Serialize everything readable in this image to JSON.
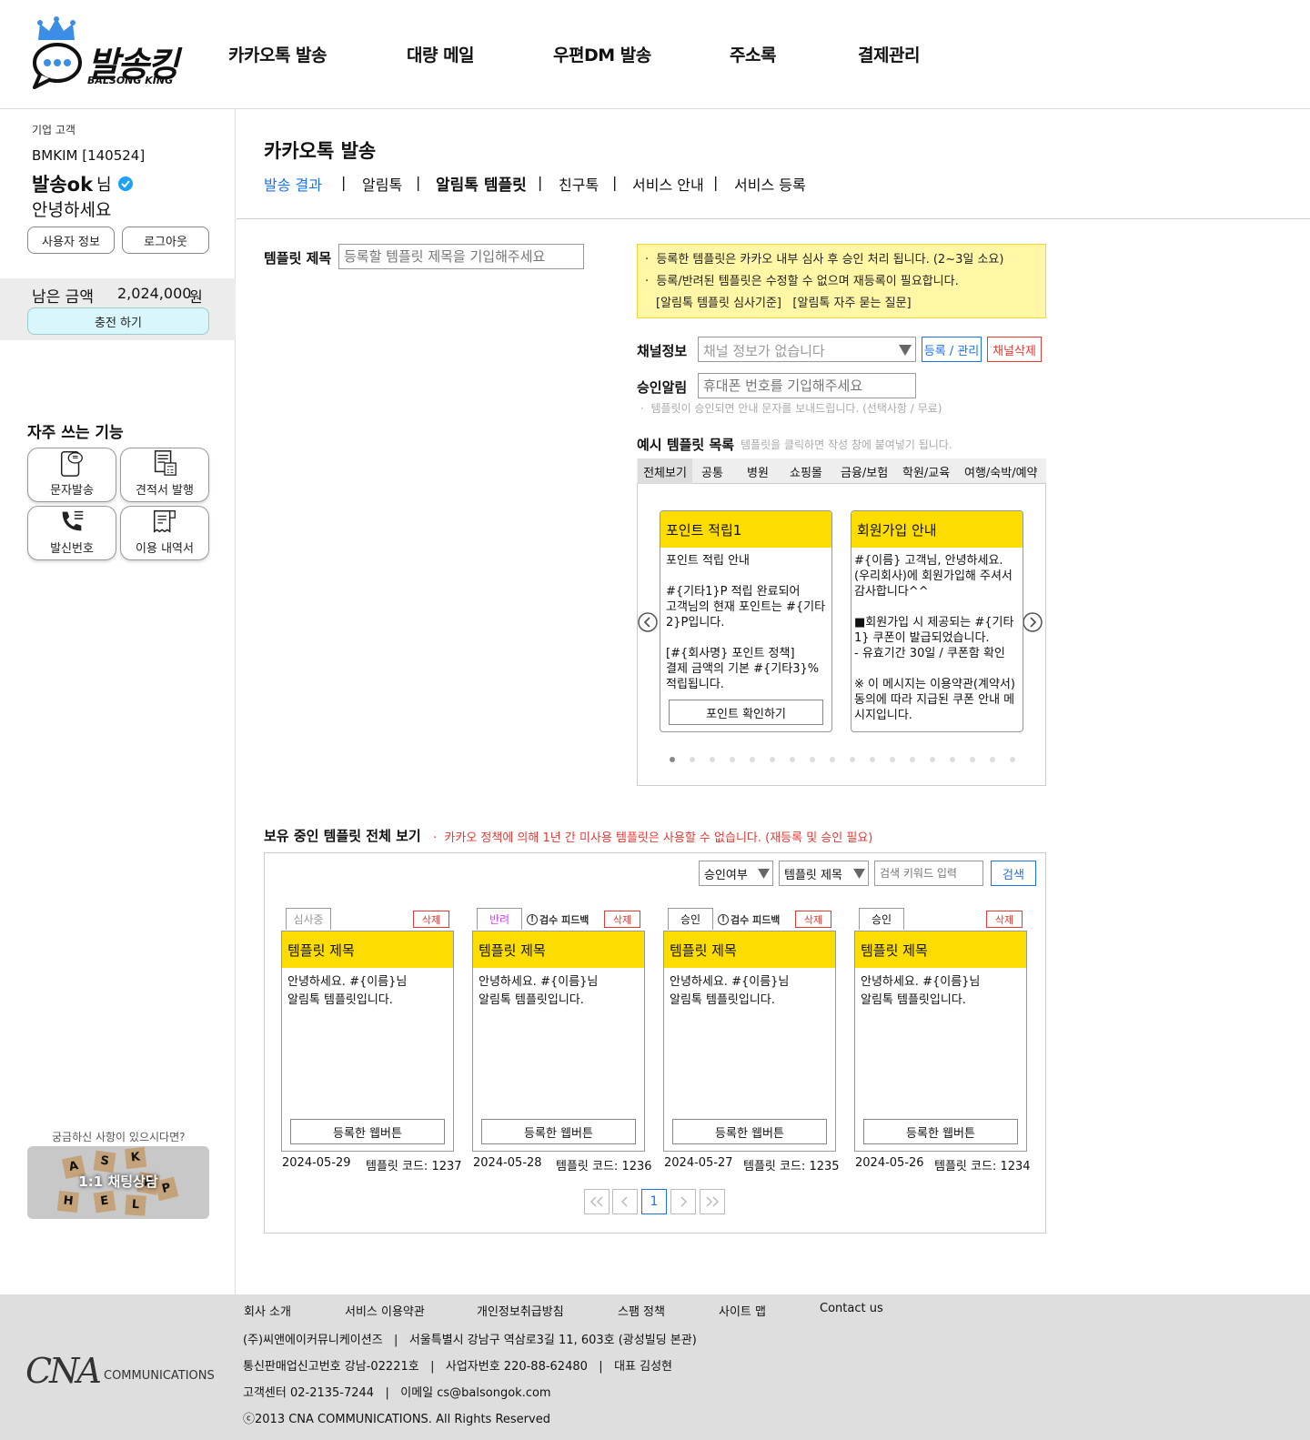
{
  "brand": {
    "name": "발송킹",
    "sub": "BALSONG KING"
  },
  "nav": [
    "카카오톡 발송",
    "대량 메일",
    "우편DM 발송",
    "주소록",
    "결제관리"
  ],
  "user": {
    "type": "기업 고객",
    "id": "BMKIM",
    "code": "[140524]",
    "name": "발송ok",
    "suffix": "님",
    "greeting": "안녕하세요",
    "user_info_btn": "사용자 정보",
    "logout_btn": "로그아웃"
  },
  "balance": {
    "label": "남은 금액",
    "amount": "2,024,000",
    "unit": "원",
    "charge_btn": "충전 하기"
  },
  "quick": {
    "title": "자주 쓰는 기능",
    "items": [
      "문자발송",
      "견적서 발행",
      "발신번호",
      "이용 내역서"
    ]
  },
  "chat": {
    "question": "궁금하신 사항이 있으시다면?",
    "label": "1:1 채팅상담",
    "tiles": [
      "A",
      "S",
      "K",
      "R",
      "P",
      "H",
      "E",
      "L"
    ]
  },
  "page": {
    "title": "카카오톡 발송",
    "subtabs": [
      "발송 결과",
      "알림톡",
      "알림톡 템플릿",
      "친구톡",
      "서비스 안내",
      "서비스 등록"
    ],
    "sep": "|"
  },
  "form": {
    "template_title_label": "템플릿 제목",
    "template_title_placeholder": "등록할 템플릿 제목을 기입해주세요",
    "channel_label": "채널정보",
    "channel_value": "채널 정보가 없습니다",
    "channel_register": "등록 / 관리",
    "channel_delete": "채널삭제",
    "approval_label": "승인알림",
    "approval_placeholder": "휴대폰 번호를 기입해주세요",
    "approval_note": "템플릿이 승인되면 안내 문자를 보내드립니다. (선택사항 / 무료)"
  },
  "notice": {
    "lines": [
      "등록한 템플릿은 카카오 내부 심사 후 승인 처리 됩니다. (2~3일 소요)",
      "등록/반려된 템플릿은 수정할 수 없으며 재등록이 필요합니다."
    ],
    "links": [
      "[알림톡 템플릿 심사기준]",
      "[알림톡 자주 묻는 질문]"
    ]
  },
  "examples": {
    "title": "예시 템플릿 목록",
    "hint": "템플릿을 클릭하면 작성 창에 붙여넣기 됩니다.",
    "tabs": [
      "전체보기",
      "공통",
      "병원",
      "쇼핑몰",
      "금융/보험",
      "학원/교육",
      "여행/숙박/예약"
    ],
    "cards": [
      {
        "title": "포인트 적립1",
        "body": "포인트 적립 안내\n\n#{기타1}P 적립 완료되어\n고객님의 현재 포인트는 #{기타2}P입니다.\n\n[#{회사명} 포인트 정책]\n결제 금액의 기본 #{기타3}%\n적립됩니다.",
        "button": "포인트 확인하기"
      },
      {
        "title": "회원가입 안내",
        "body": "#{이름} 고객님, 안녕하세요.\n(우리회사)에 회원가입해 주셔서 감사합니다^^\n\n■회원가입 시 제공되는 #{기타1} 쿠폰이 발급되었습니다.\n- 유효기간 30일 / 쿠폰함 확인\n\n※ 이 메시지는 이용약관(계약서) 동의에 따라 지급된 쿠폰 안내 메시지입니다."
      }
    ],
    "dots": 18
  },
  "owned": {
    "title": "보유 중인 템플릿 전체 보기",
    "warning": "카카오 정책에 의해 1년 간 미사용 템플릿은 사용할 수 없습니다. (재등록 및 승인 필요)",
    "filter1": "승인여부",
    "filter2": "템플릿 제목",
    "search_placeholder": "검색 키워드 입력",
    "search_btn": "검색",
    "feedback": "검수 피드백",
    "delete": "삭제",
    "webbtn": "등록한 웹버튼",
    "code_label": "템플릿 코드:",
    "items": [
      {
        "status": "심사중",
        "status_color": "#999999",
        "title": "템플릿 제목",
        "body": "안녕하세요. #{이름}님\n알림톡 템플릿입니다.",
        "date": "2024-05-29",
        "code": "1237",
        "feedback": false
      },
      {
        "status": "반려",
        "status_color": "#e040fb",
        "title": "템플릿 제목",
        "body": "안녕하세요. #{이름}님\n알림톡 템플릿입니다.",
        "date": "2024-05-28",
        "code": "1236",
        "feedback": true
      },
      {
        "status": "승인",
        "status_color": "#111111",
        "title": "템플릿 제목",
        "body": "안녕하세요. #{이름}님\n알림톡 템플릿입니다.",
        "date": "2024-05-27",
        "code": "1235",
        "feedback": true
      },
      {
        "status": "승인",
        "status_color": "#111111",
        "title": "템플릿 제목",
        "body": "안녕하세요. #{이름}님\n알림톡 템플릿입니다.",
        "date": "2024-05-26",
        "code": "1234",
        "feedback": false
      }
    ],
    "page": "1"
  },
  "footer": {
    "links": [
      "회사 소개",
      "서비스 이용약관",
      "개인정보취급방침",
      "스팸 정책",
      "사이트 맵",
      "Contact us"
    ],
    "lines": [
      "(주)씨앤에이커뮤니케이션즈   |   서울특별시 강남구 역삼로3길 11, 603호 (광성빌딩 본관)",
      "통신판매업신고번호 강남-02221호   |   사업자번호 220-88-62480   |   대표 김성현",
      "고객센터 02-2135-7244   |   이메일 cs@balsongok.com",
      "ⓒ2013 CNA COMMUNICATIONS. All Rights Reserved"
    ],
    "logo_main": "CNA",
    "logo_sub": "COMMUNICATIONS"
  },
  "colors": {
    "accent": "#1a73e8",
    "yellow": "#fddc00",
    "danger": "#e53935",
    "charge_bg": "#d8f6fb"
  }
}
